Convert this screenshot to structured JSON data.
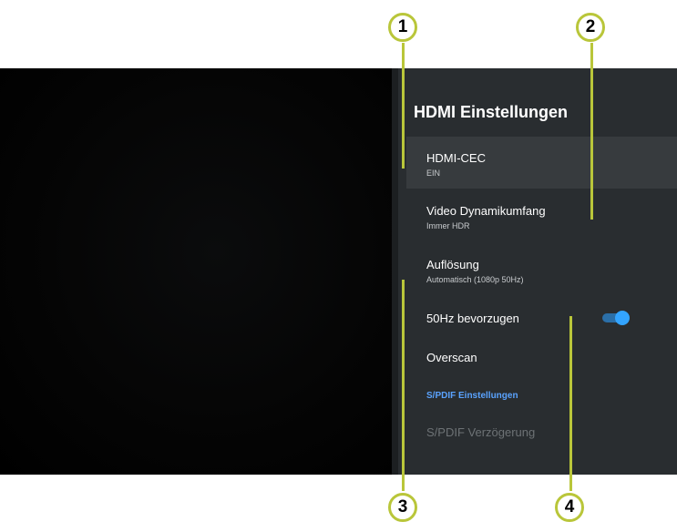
{
  "panel": {
    "title": "HDMI Einstellungen",
    "items": [
      {
        "label": "HDMI-CEC",
        "value": "EIN"
      },
      {
        "label": "Video Dynamikumfang",
        "value": "Immer HDR"
      },
      {
        "label": "Auflösung",
        "value": "Automatisch (1080p 50Hz)"
      },
      {
        "label": "50Hz bevorzugen",
        "toggle_on": true
      },
      {
        "label": "Overscan"
      },
      {
        "label": "S/PDIF Einstellungen"
      },
      {
        "label": "S/PDIF Verzögerung"
      }
    ]
  },
  "callouts": [
    "1",
    "2",
    "3",
    "4"
  ],
  "colors": {
    "panel_bg": "#292d30",
    "selected_bg": "#373b3e",
    "accent_blue": "#5aa3ff",
    "toggle_on": "#33a4ff",
    "callout_green": "#b9c63a"
  }
}
